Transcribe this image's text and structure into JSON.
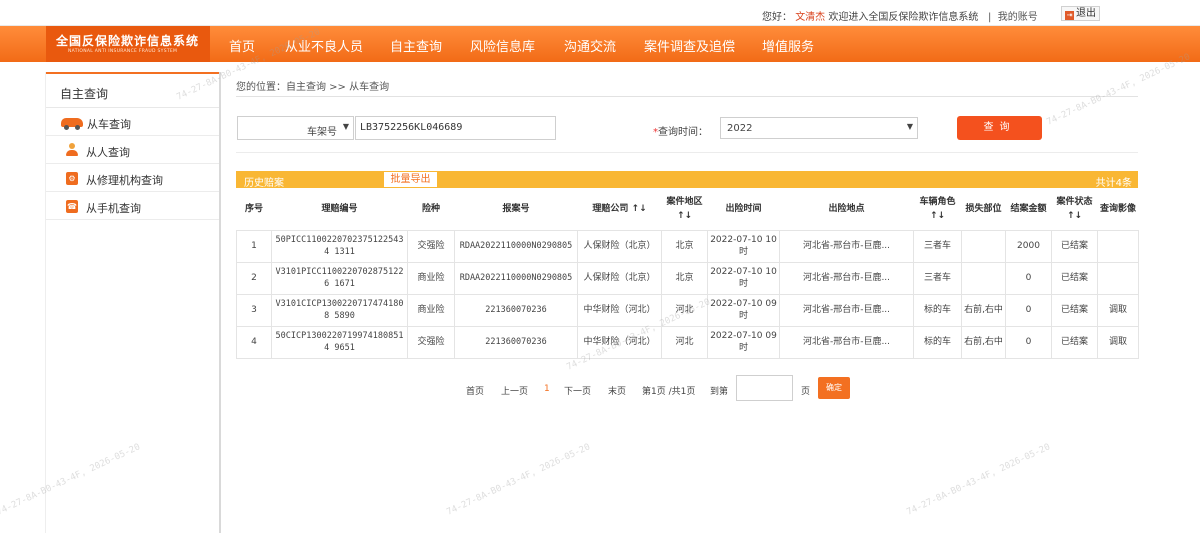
{
  "topbar": {
    "greeting_prefix": "您好：",
    "username": "文清杰",
    "welcome": "欢迎进入全国反保险欺诈信息系统",
    "separator": "|",
    "my_account": "我的账号",
    "logout": "退出"
  },
  "logo": {
    "title": "全国反保险欺诈信息系统",
    "subtitle": "NATIONAL ANTI INSURANCE FRAUD SYSTEM"
  },
  "nav": {
    "items": [
      "首页",
      "从业不良人员",
      "自主查询",
      "风险信息库",
      "沟通交流",
      "案件调查及追偿",
      "增值服务"
    ]
  },
  "sidebar": {
    "title": "自主查询",
    "items": [
      {
        "label": "从车查询",
        "icon": "car-icon"
      },
      {
        "label": "从人查询",
        "icon": "person-icon"
      },
      {
        "label": "从修理机构查询",
        "icon": "repair-shop-icon"
      },
      {
        "label": "从手机查询",
        "icon": "phone-icon"
      }
    ]
  },
  "breadcrumb": "您的位置：自主查询 >> 从车查询",
  "query": {
    "type_selected": "车架号",
    "plate_value": "LB3752256KL046689",
    "time_required_mark": "*",
    "time_label": "查询时间：",
    "time_selected": "2022",
    "query_button": "查询"
  },
  "results": {
    "bar_title": "历史赔案",
    "export_button": "批量导出",
    "total": "共计4条",
    "columns": [
      "序号",
      "理赔编号",
      "险种",
      "报案号",
      "理赔公司 ↑↓",
      "案件地区 ↑↓",
      "出险时间",
      "出险地点",
      "车辆角色 ↑↓",
      "损失部位",
      "结案金额",
      "案件状态 ↑↓",
      "查询影像"
    ],
    "rows": [
      [
        "1",
        "50PICC11002207023751225434 1311",
        "交强险",
        "RDAA2022110000N0290805",
        "人保财险（北京）",
        "北京",
        "2022-07-10 10时",
        "河北省-邢台市-巨鹿...",
        "三者车",
        "",
        "2000",
        "已结案",
        ""
      ],
      [
        "2",
        "V3101PICC11002207028751226 1671",
        "商业险",
        "RDAA2022110000N0290805",
        "人保财险（北京）",
        "北京",
        "2022-07-10 10时",
        "河北省-邢台市-巨鹿...",
        "三者车",
        "",
        "0",
        "已结案",
        ""
      ],
      [
        "3",
        "V3101CICP13002207174741808 5890",
        "商业险",
        "221360070236",
        "中华财险（河北）",
        "河北",
        "2022-07-10 09时",
        "河北省-邢台市-巨鹿...",
        "标的车",
        "右前,右中",
        "0",
        "已结案",
        "调取"
      ],
      [
        "4",
        "50CICP13002207199741808514 9651",
        "交强险",
        "221360070236",
        "中华财险（河北）",
        "河北",
        "2022-07-10 09时",
        "河北省-邢台市-巨鹿...",
        "标的车",
        "右前,右中",
        "0",
        "已结案",
        "调取"
      ]
    ]
  },
  "pager": {
    "first": "首页",
    "prev": "上一页",
    "current": "1",
    "next": "下一页",
    "last": "末页",
    "info": "第1页 /共1页",
    "goto": "到第",
    "page_unit": "页",
    "confirm": "确定"
  },
  "watermark": "74-27-8A-B0-43-4F, 2026-05-20",
  "colors": {
    "accent": "#f37021",
    "nav": "#f26b17",
    "bar": "#f9b734",
    "button": "#f4511e"
  }
}
